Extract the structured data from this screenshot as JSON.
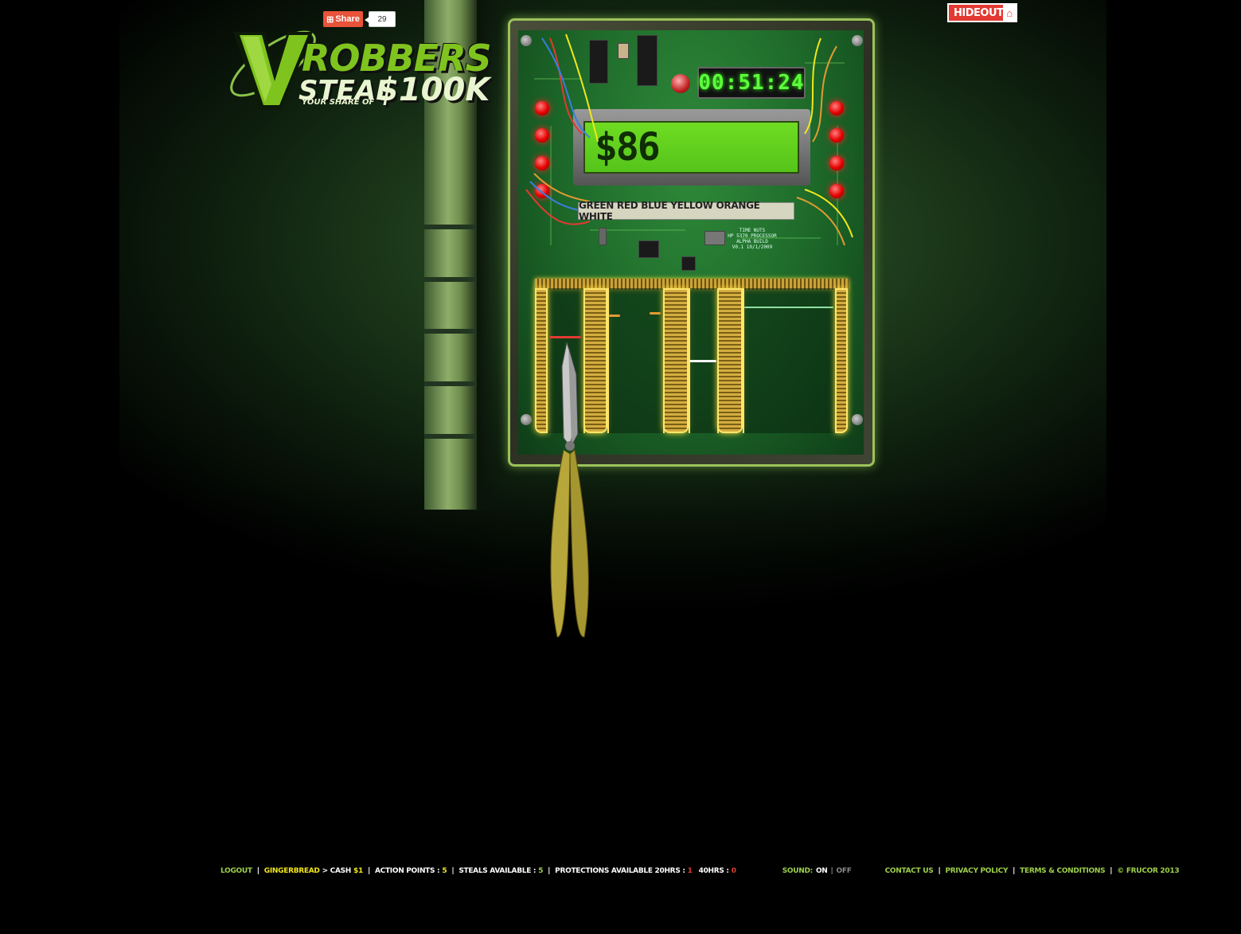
{
  "logo": {
    "brand": "ROBBERS",
    "tagline": "STEAL",
    "tagline_small": "YOUR SHARE OF",
    "prize": "$100K"
  },
  "share": {
    "label": "Share",
    "count": "29"
  },
  "hideout": {
    "label": "HIDEOUT",
    "icon": "home-icon"
  },
  "device": {
    "timer": "00:51:24",
    "amount": "$86",
    "wire_order": "GREEN RED BLUE YELLOW ORANGE WHITE",
    "chip_label": "TIME NUTS\nHP 5370 PROCESSOR\nALPHA BUILD\nV0.1 10/1/2009"
  },
  "footer": {
    "logout": "LOGOUT",
    "username": "GINGERBREAD",
    "cash_label": "> CASH",
    "cash_value": "$1",
    "action_points_label": "ACTION POINTS :",
    "action_points_value": "5",
    "steals_label": "STEALS AVAILABLE :",
    "steals_value": "5",
    "protections_label": "PROTECTIONS AVAILABLE 20HRS :",
    "protections_20_value": "1",
    "protections_40_label": "40HRS :",
    "protections_40_value": "0",
    "sound_label": "SOUND:",
    "sound_on": "ON",
    "sound_off": "OFF",
    "contact": "CONTACT US",
    "privacy": "PRIVACY POLICY",
    "terms": "TERMS & CONDITIONS",
    "copyright": "© FRUCOR 2013"
  },
  "colors": {
    "accent_green": "#9ed04a",
    "highlight_yellow": "#f2e71a",
    "alert_red": "#e23a32",
    "lcd_green": "#5cff3a"
  }
}
